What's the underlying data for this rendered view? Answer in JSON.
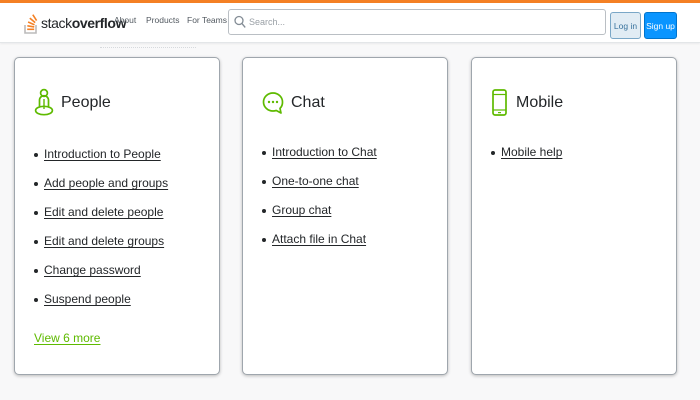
{
  "header": {
    "logo": {
      "prefix": "stack",
      "bold": "overflow",
      "icon": "stack-overflow-logo-icon"
    },
    "nav": [
      "About",
      "Products",
      "For Teams"
    ],
    "search": {
      "placeholder": "Search...",
      "value": "",
      "icon": "search-icon"
    },
    "login_label": "Log in",
    "signup_label": "Sign up"
  },
  "cards": {
    "people": {
      "title": "People",
      "icon": "person-icon",
      "links": [
        "Introduction to People",
        "Add people and groups",
        "Edit and delete people",
        "Edit and delete groups",
        "Change password",
        "Suspend people"
      ],
      "more_label": "View 6 more"
    },
    "chat": {
      "title": "Chat",
      "icon": "chat-bubble-icon",
      "links": [
        "Introduction to Chat",
        "One-to-one chat",
        "Group chat",
        "Attach file in Chat"
      ]
    },
    "mobile": {
      "title": "Mobile",
      "icon": "mobile-phone-icon",
      "links": [
        "Mobile help"
      ]
    }
  },
  "colors": {
    "accent_orange": "#f48024",
    "icon_green": "#5eba00",
    "signup_blue": "#0a95ff",
    "login_bg": "#e1ecf4"
  }
}
